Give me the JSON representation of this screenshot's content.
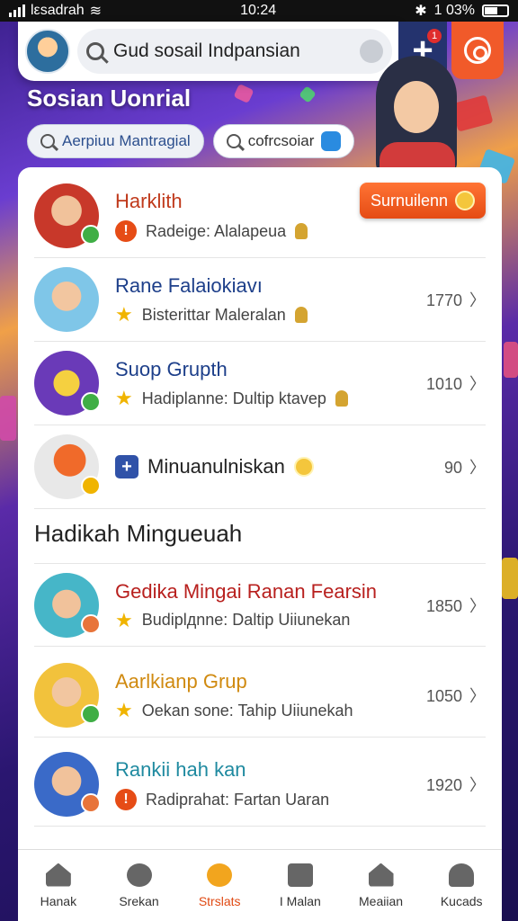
{
  "status_bar": {
    "carrier": "lεsadrah",
    "time": "10:24",
    "battery": "1 03%"
  },
  "search": {
    "value": "Gud sosail Indpansian"
  },
  "header": {
    "notification_count": "1"
  },
  "hero": {
    "title": "Sosian Uonrial"
  },
  "chips": [
    {
      "label": "Aerpiuu Mantragial"
    },
    {
      "label": "cofrcsoiar"
    }
  ],
  "top_list": [
    {
      "name": "Harklith",
      "subtitle": "Radeige: Alalapeua",
      "action": "Surnuilenn",
      "name_color": "#c03a1c"
    },
    {
      "name": "Rane Falaiokiavı",
      "subtitle": "Bisterittar Maleralan",
      "count": "1770",
      "name_color": "#1d3f8a"
    },
    {
      "name": "Suop Grupth",
      "subtitle": "Hadiplanne: Dultip ktavep",
      "count": "1010",
      "name_color": "#1d3f8a"
    },
    {
      "name": "Minuanulniskan",
      "count": "90"
    }
  ],
  "section": {
    "title": "Hadikah Mingueuah"
  },
  "bottom_list": [
    {
      "name": "Gedika Mingai Ranan Fearsin",
      "subtitle": "Budiplдnne: Daltip Uiiunekan",
      "count": "1850",
      "name_color": "#b8201e"
    },
    {
      "name": "Aarlkianp Grup",
      "subtitle": "Oekan sone: Tahip Uiiunekah",
      "count": "1050",
      "name_color": "#d08a10"
    },
    {
      "name": "Rankii hah kan",
      "subtitle": "Radiprahat: Fartan Uaran",
      "count": "1920",
      "name_color": "#1f8aa0"
    }
  ],
  "nav": [
    {
      "label": "Hanak",
      "icon": "home-icon"
    },
    {
      "label": "Srekan",
      "icon": "search-icon"
    },
    {
      "label": "Strslats",
      "icon": "stats-icon",
      "active": true
    },
    {
      "label": "I Malan",
      "icon": "mail-icon"
    },
    {
      "label": "Meaiian",
      "icon": "media-icon"
    },
    {
      "label": "Kucads",
      "icon": "user-icon"
    }
  ]
}
